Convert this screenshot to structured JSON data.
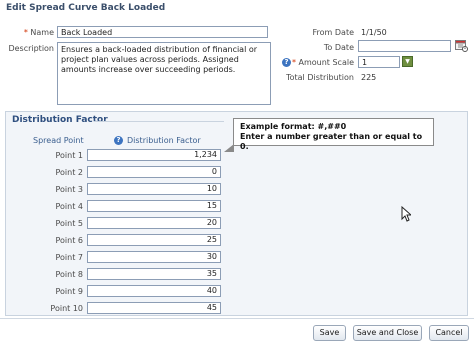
{
  "page": {
    "title": "Edit Spread Curve Back Loaded"
  },
  "form": {
    "name_required_marker": "*",
    "name_label": "Name",
    "name_value": "Back Loaded",
    "description_label": "Description",
    "description_value": "Ensures a back-loaded distribution of financial or project plan values across periods. Assigned amounts increase over succeeding periods.",
    "from_date_label": "From Date",
    "from_date_value": "1/1/50",
    "to_date_label": "To Date",
    "to_date_value": "",
    "amount_scale_required_marker": "*",
    "amount_scale_label": "Amount Scale",
    "amount_scale_value": "1",
    "total_distribution_label": "Total Distribution",
    "total_distribution_value": "225"
  },
  "distribution": {
    "section_title": "Distribution Factor",
    "col_spread_point": "Spread Point",
    "col_distribution_factor": "Distribution Factor",
    "points": [
      {
        "label": "Point 1",
        "value": "1,234"
      },
      {
        "label": "Point 2",
        "value": "0"
      },
      {
        "label": "Point 3",
        "value": "10"
      },
      {
        "label": "Point 4",
        "value": "15"
      },
      {
        "label": "Point 5",
        "value": "20"
      },
      {
        "label": "Point 6",
        "value": "25"
      },
      {
        "label": "Point 7",
        "value": "30"
      },
      {
        "label": "Point 8",
        "value": "35"
      },
      {
        "label": "Point 9",
        "value": "40"
      },
      {
        "label": "Point 10",
        "value": "45"
      }
    ]
  },
  "tooltip": {
    "line1": "Example format: #,##0",
    "line2": "Enter a number greater than or equal to 0."
  },
  "buttons": {
    "save": "Save",
    "save_and_close": "Save and Close",
    "cancel": "Cancel"
  },
  "icons": {
    "help": "?",
    "dropdown": "▼"
  },
  "colors": {
    "title": "#3b4f6b",
    "required": "#d03000",
    "help_icon": "#3d74c0",
    "section_title": "#2f4f7f"
  }
}
